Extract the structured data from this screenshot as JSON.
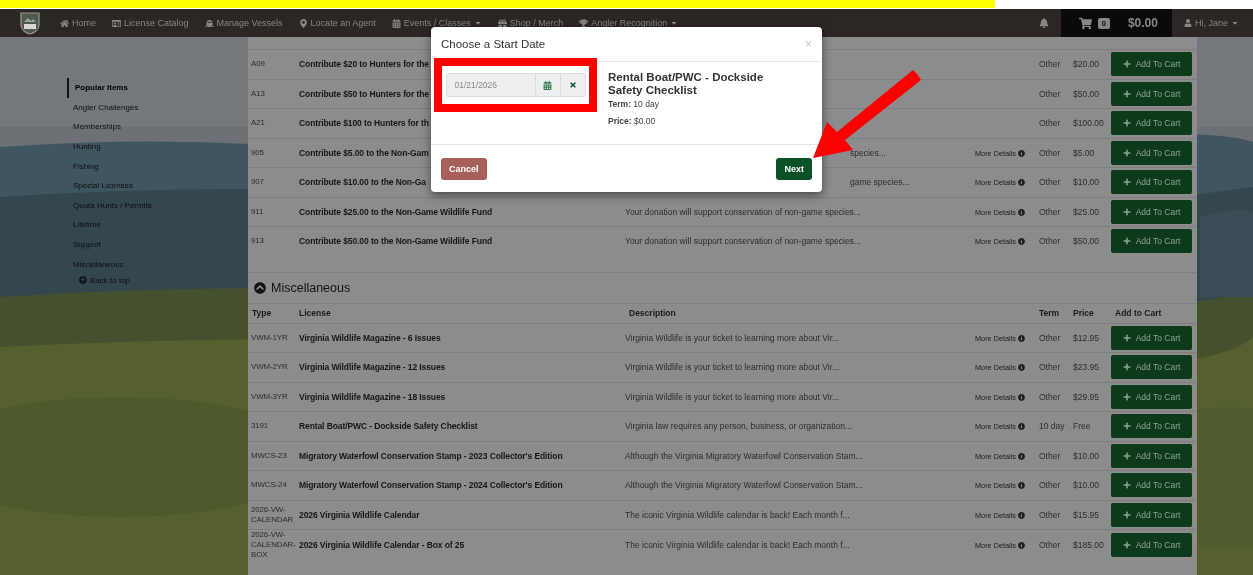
{
  "navbar": {
    "items": [
      {
        "label": "Home",
        "dropdown": false
      },
      {
        "label": "License Catalog",
        "dropdown": false
      },
      {
        "label": "Manage Vessels",
        "dropdown": false
      },
      {
        "label": "Locate an Agent",
        "dropdown": false
      },
      {
        "label": "Events / Classes",
        "dropdown": true
      },
      {
        "label": "Shop / Merch",
        "dropdown": false
      },
      {
        "label": "Angler Recognition",
        "dropdown": true
      }
    ],
    "cart": {
      "count": "0",
      "total": "$0.00"
    },
    "user": {
      "label": "Hi, Jane",
      "dropdown": true
    }
  },
  "sidebar": {
    "items": [
      {
        "label": "Popular Items",
        "selected": true
      },
      {
        "label": "Angler Challenges",
        "selected": false
      },
      {
        "label": "Memberships",
        "selected": false
      },
      {
        "label": "Hunting",
        "selected": false
      },
      {
        "label": "Fishing",
        "selected": false
      },
      {
        "label": "Special Licenses",
        "selected": false
      },
      {
        "label": "Quota Hunts / Permits",
        "selected": false
      },
      {
        "label": "Lifetime",
        "selected": false
      },
      {
        "label": "Support",
        "selected": false
      },
      {
        "label": "Miscellaneous",
        "selected": false
      }
    ],
    "back_to_top": "Back to top"
  },
  "top_table": {
    "rows": [
      {
        "type": "A09",
        "license": "Contribute $20 to Hunters for the",
        "term": "Other",
        "price": "$20.00",
        "button": "Add To Cart"
      },
      {
        "type": "A13",
        "license": "Contribute $50 to Hunters for the",
        "term": "Other",
        "price": "$50.00",
        "button": "Add To Cart"
      },
      {
        "type": "A21",
        "license": "Contribute $100 to Hunters for th",
        "term": "Other",
        "price": "$100.00",
        "button": "Add To Cart"
      },
      {
        "type": "905",
        "license": "Contribute $5.00 to the Non-Gam",
        "description": "species...",
        "description_partial": true,
        "more_details": "More Details",
        "term": "Other",
        "price": "$5.00",
        "button": "Add To Cart"
      },
      {
        "type": "907",
        "license": "Contribute $10.00 to the Non-Ga",
        "description": "game species...",
        "description_partial": true,
        "more_details": "More Details",
        "term": "Other",
        "price": "$10.00",
        "button": "Add To Cart"
      },
      {
        "type": "911",
        "license": "Contribute $25.00 to the Non-Game Wildlife Fund",
        "description": "Your donation will support conservation of non-game species...",
        "more_details": "More Details",
        "term": "Other",
        "price": "$25.00",
        "button": "Add To Cart"
      },
      {
        "type": "913",
        "license": "Contribute $50.00 to the Non-Game Wildlife Fund",
        "description": "Your donation will support conservation of non-game species...",
        "more_details": "More Details",
        "term": "Other",
        "price": "$50.00",
        "button": "Add To Cart"
      }
    ]
  },
  "miscellaneous": {
    "title": "Miscellaneous",
    "columns": [
      "Type",
      "License",
      "Description",
      "Term",
      "Price",
      "Add to Cart"
    ],
    "rows": [
      {
        "type": "VWM-1YR",
        "license": "Virginia Wildlife Magazine - 6 Issues",
        "description": "Virginia Wildlife is your ticket to learning more about Vir...",
        "more_details": "More Details",
        "term": "Other",
        "price": "$12.95",
        "button": "Add To Cart"
      },
      {
        "type": "VWM-2YR",
        "license": "Virginia Wildlife Magazine - 12 Issues",
        "description": "Virginia Wildlife is your ticket to learning more about Vir...",
        "more_details": "More Details",
        "term": "Other",
        "price": "$23.95",
        "button": "Add To Cart"
      },
      {
        "type": "VWM-3YR",
        "license": "Virginia Wildlife Magazine - 18 Issues",
        "description": "Virginia Wildlife is your ticket to learning more about Vir...",
        "more_details": "More Details",
        "term": "Other",
        "price": "$29.95",
        "button": "Add To Cart"
      },
      {
        "type": "3191",
        "license": "Rental Boat/PWC - Dockside Safety Checklist",
        "description": "Virginia law requires any person, business, or organization...",
        "more_details": "More Details",
        "term": "10 day",
        "price": "Free",
        "button": "Add To Cart"
      },
      {
        "type": "MWCS-23",
        "license": "Migratory Waterfowl Conservation Stamp - 2023 Collector's Edition",
        "description": "Although the Virginia Migratory Waterfowl Conservation Stam...",
        "more_details": "More Details",
        "term": "Other",
        "price": "$10.00",
        "button": "Add To Cart"
      },
      {
        "type": "MWCS-24",
        "license": "Migratory Waterfowl Conservation Stamp - 2024 Collector's Edition",
        "description": "Although the Virginia Migratory Waterfowl Conservation Stam...",
        "more_details": "More Details",
        "term": "Other",
        "price": "$10.00",
        "button": "Add To Cart"
      },
      {
        "type": "2026-VW-CALENDAR",
        "license": "2026 Virginia Wildlife Calendar",
        "description": "The iconic Virginia Wildlife calendar is back! Each month f...",
        "more_details": "More Details",
        "term": "Other",
        "price": "$15.95",
        "button": "Add To Cart"
      },
      {
        "type": "2026-VW-CALENDAR-BOX",
        "license": "2026 Virginia Wildlife Calendar - Box of 25",
        "description": "The iconic Virginia Wildlife calendar is back! Each month f...",
        "more_details": "More Details",
        "term": "Other",
        "price": "$185.00",
        "button": "Add To Cart"
      }
    ]
  },
  "modal": {
    "title": "Choose a Start Date",
    "close": "×",
    "date": "01/21/2026",
    "item_title": "Rental Boat/PWC - Dockside Safety Checklist",
    "term": "**Term:** 10 day",
    "price": "**Price:** $0.00",
    "cancel": "Cancel",
    "next": "Next"
  }
}
